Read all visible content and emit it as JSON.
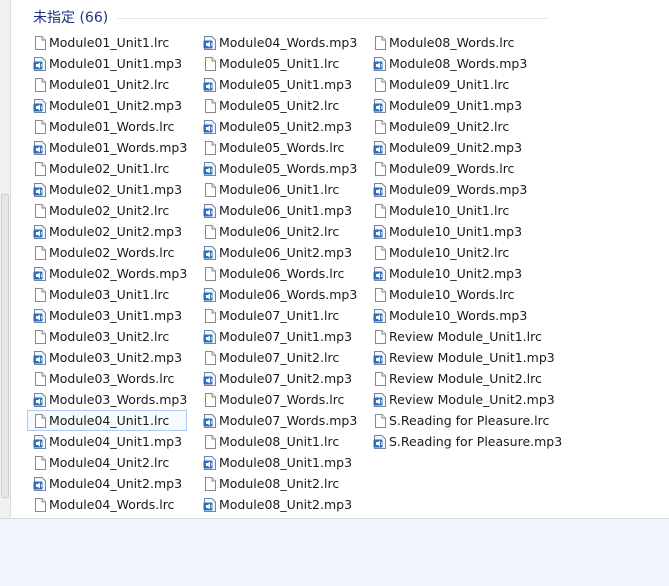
{
  "group": {
    "title": "未指定 (66)"
  },
  "columns": [
    [
      {
        "name": "Module01_Unit1.lrc",
        "type": "lrc"
      },
      {
        "name": "Module01_Unit1.mp3",
        "type": "mp3"
      },
      {
        "name": "Module01_Unit2.lrc",
        "type": "lrc"
      },
      {
        "name": "Module01_Unit2.mp3",
        "type": "mp3"
      },
      {
        "name": "Module01_Words.lrc",
        "type": "lrc"
      },
      {
        "name": "Module01_Words.mp3",
        "type": "mp3"
      },
      {
        "name": "Module02_Unit1.lrc",
        "type": "lrc"
      },
      {
        "name": "Module02_Unit1.mp3",
        "type": "mp3"
      },
      {
        "name": "Module02_Unit2.lrc",
        "type": "lrc"
      },
      {
        "name": "Module02_Unit2.mp3",
        "type": "mp3"
      },
      {
        "name": "Module02_Words.lrc",
        "type": "lrc"
      },
      {
        "name": "Module02_Words.mp3",
        "type": "mp3"
      },
      {
        "name": "Module03_Unit1.lrc",
        "type": "lrc"
      },
      {
        "name": "Module03_Unit1.mp3",
        "type": "mp3"
      },
      {
        "name": "Module03_Unit2.lrc",
        "type": "lrc"
      },
      {
        "name": "Module03_Unit2.mp3",
        "type": "mp3"
      },
      {
        "name": "Module03_Words.lrc",
        "type": "lrc"
      },
      {
        "name": "Module03_Words.mp3",
        "type": "mp3"
      },
      {
        "name": "Module04_Unit1.lrc",
        "type": "lrc",
        "selected": true
      },
      {
        "name": "Module04_Unit1.mp3",
        "type": "mp3"
      },
      {
        "name": "Module04_Unit2.lrc",
        "type": "lrc"
      },
      {
        "name": "Module04_Unit2.mp3",
        "type": "mp3"
      },
      {
        "name": "Module04_Words.lrc",
        "type": "lrc"
      }
    ],
    [
      {
        "name": "Module04_Words.mp3",
        "type": "mp3"
      },
      {
        "name": "Module05_Unit1.lrc",
        "type": "lrc"
      },
      {
        "name": "Module05_Unit1.mp3",
        "type": "mp3"
      },
      {
        "name": "Module05_Unit2.lrc",
        "type": "lrc"
      },
      {
        "name": "Module05_Unit2.mp3",
        "type": "mp3"
      },
      {
        "name": "Module05_Words.lrc",
        "type": "lrc"
      },
      {
        "name": "Module05_Words.mp3",
        "type": "mp3"
      },
      {
        "name": "Module06_Unit1.lrc",
        "type": "lrc"
      },
      {
        "name": "Module06_Unit1.mp3",
        "type": "mp3"
      },
      {
        "name": "Module06_Unit2.lrc",
        "type": "lrc"
      },
      {
        "name": "Module06_Unit2.mp3",
        "type": "mp3"
      },
      {
        "name": "Module06_Words.lrc",
        "type": "lrc"
      },
      {
        "name": "Module06_Words.mp3",
        "type": "mp3"
      },
      {
        "name": "Module07_Unit1.lrc",
        "type": "lrc"
      },
      {
        "name": "Module07_Unit1.mp3",
        "type": "mp3"
      },
      {
        "name": "Module07_Unit2.lrc",
        "type": "lrc"
      },
      {
        "name": "Module07_Unit2.mp3",
        "type": "mp3"
      },
      {
        "name": "Module07_Words.lrc",
        "type": "lrc"
      },
      {
        "name": "Module07_Words.mp3",
        "type": "mp3"
      },
      {
        "name": "Module08_Unit1.lrc",
        "type": "lrc"
      },
      {
        "name": "Module08_Unit1.mp3",
        "type": "mp3"
      },
      {
        "name": "Module08_Unit2.lrc",
        "type": "lrc"
      },
      {
        "name": "Module08_Unit2.mp3",
        "type": "mp3"
      }
    ],
    [
      {
        "name": "Module08_Words.lrc",
        "type": "lrc"
      },
      {
        "name": "Module08_Words.mp3",
        "type": "mp3"
      },
      {
        "name": "Module09_Unit1.lrc",
        "type": "lrc"
      },
      {
        "name": "Module09_Unit1.mp3",
        "type": "mp3"
      },
      {
        "name": "Module09_Unit2.lrc",
        "type": "lrc"
      },
      {
        "name": "Module09_Unit2.mp3",
        "type": "mp3"
      },
      {
        "name": "Module09_Words.lrc",
        "type": "lrc"
      },
      {
        "name": "Module09_Words.mp3",
        "type": "mp3"
      },
      {
        "name": "Module10_Unit1.lrc",
        "type": "lrc"
      },
      {
        "name": "Module10_Unit1.mp3",
        "type": "mp3"
      },
      {
        "name": "Module10_Unit2.lrc",
        "type": "lrc"
      },
      {
        "name": "Module10_Unit2.mp3",
        "type": "mp3"
      },
      {
        "name": "Module10_Words.lrc",
        "type": "lrc"
      },
      {
        "name": "Module10_Words.mp3",
        "type": "mp3"
      },
      {
        "name": "Review Module_Unit1.lrc",
        "type": "lrc"
      },
      {
        "name": "Review Module_Unit1.mp3",
        "type": "mp3"
      },
      {
        "name": "Review Module_Unit2.lrc",
        "type": "lrc"
      },
      {
        "name": "Review Module_Unit2.mp3",
        "type": "mp3"
      },
      {
        "name": "S.Reading for Pleasure.lrc",
        "type": "lrc"
      },
      {
        "name": "S.Reading for Pleasure.mp3",
        "type": "mp3"
      }
    ]
  ],
  "icons": {
    "lrc": "text-file-icon",
    "mp3": "audio-file-icon"
  },
  "colors": {
    "header": "#1e3287",
    "selection_border": "#aecdf0",
    "selection_fill": "#f6fafe"
  }
}
